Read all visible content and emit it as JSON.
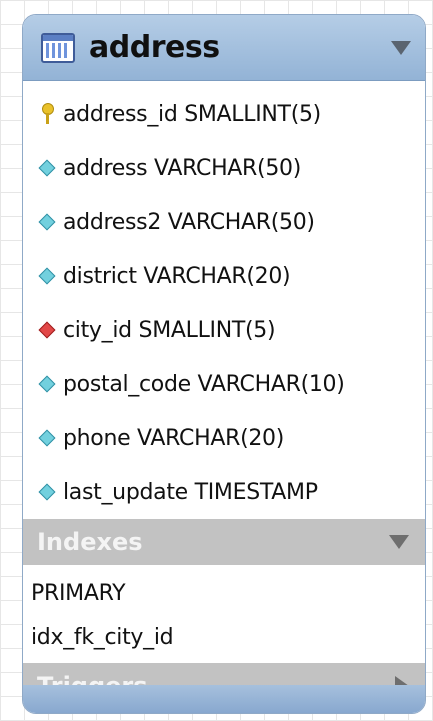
{
  "table": {
    "name": "address",
    "columns": [
      {
        "icon": "primary-key-icon",
        "text": "address_id SMALLINT(5)"
      },
      {
        "icon": "attribute-diamond-icon",
        "text": "address VARCHAR(50)"
      },
      {
        "icon": "attribute-diamond-icon",
        "text": "address2 VARCHAR(50)"
      },
      {
        "icon": "attribute-diamond-icon",
        "text": "district VARCHAR(20)"
      },
      {
        "icon": "foreign-key-diamond-icon",
        "text": "city_id SMALLINT(5)"
      },
      {
        "icon": "attribute-diamond-icon",
        "text": "postal_code VARCHAR(10)"
      },
      {
        "icon": "attribute-diamond-icon",
        "text": "phone VARCHAR(20)"
      },
      {
        "icon": "attribute-diamond-icon",
        "text": "last_update TIMESTAMP"
      }
    ]
  },
  "indexes": {
    "label": "Indexes",
    "items": [
      "PRIMARY",
      "idx_fk_city_id"
    ]
  },
  "triggers": {
    "label": "Triggers"
  },
  "colors": {
    "header": "#a3c0e0",
    "section_bar": "#c2c2c2",
    "primary_key": "#e9c12a",
    "attribute": "#72d0de",
    "foreign_key": "#e24848"
  }
}
